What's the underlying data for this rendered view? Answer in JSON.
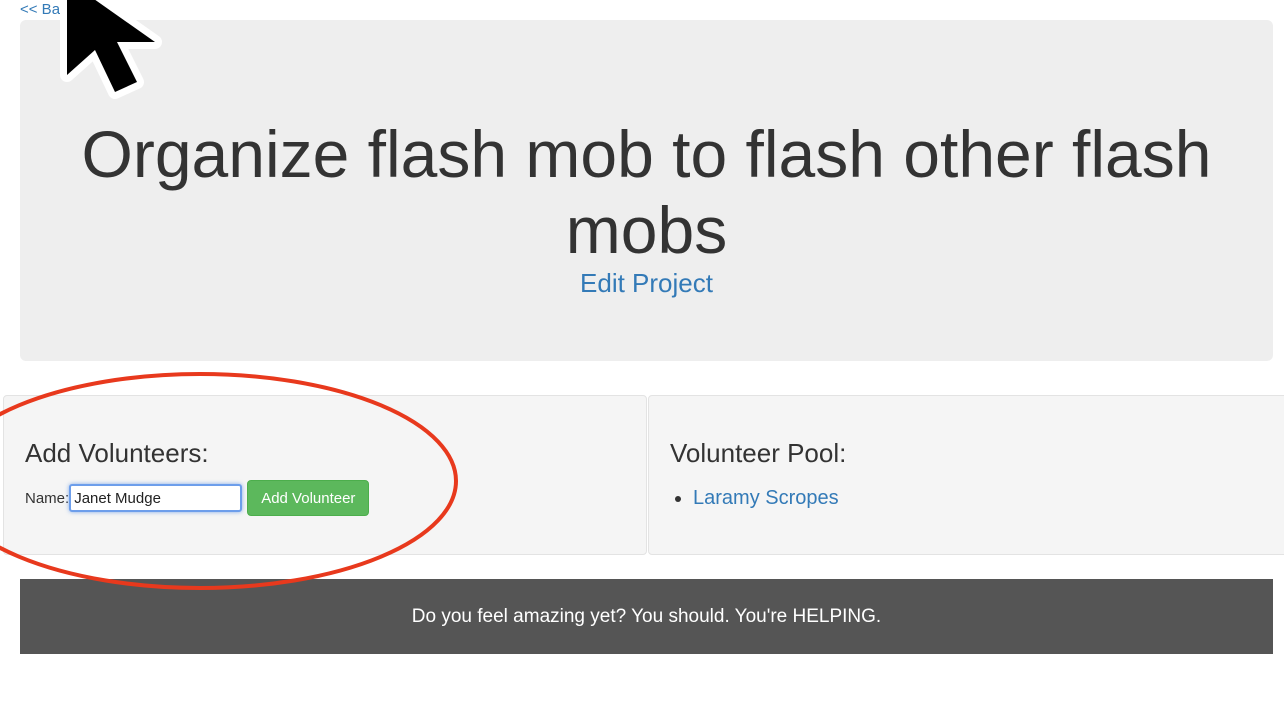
{
  "nav": {
    "back_label": "<< Back"
  },
  "project": {
    "title": "Organize flash mob to flash other flash mobs",
    "edit_label": "Edit Project"
  },
  "add_volunteers": {
    "heading": "Add Volunteers:",
    "name_label": "Name:",
    "name_value": "Janet Mudge",
    "button_label": "Add Volunteer"
  },
  "volunteer_pool": {
    "heading": "Volunteer Pool:",
    "items": [
      {
        "label": "Laramy Scropes"
      }
    ]
  },
  "footer": {
    "text": "Do you feel amazing yet? You should. You're HELPING."
  },
  "colors": {
    "link": "#337ab7",
    "success": "#5cb85c",
    "jumbotron": "#eeeeee",
    "footer_bg": "#555555",
    "annotation": "#e8391d"
  },
  "icons": {
    "cursor": "mouse-pointer-icon"
  }
}
